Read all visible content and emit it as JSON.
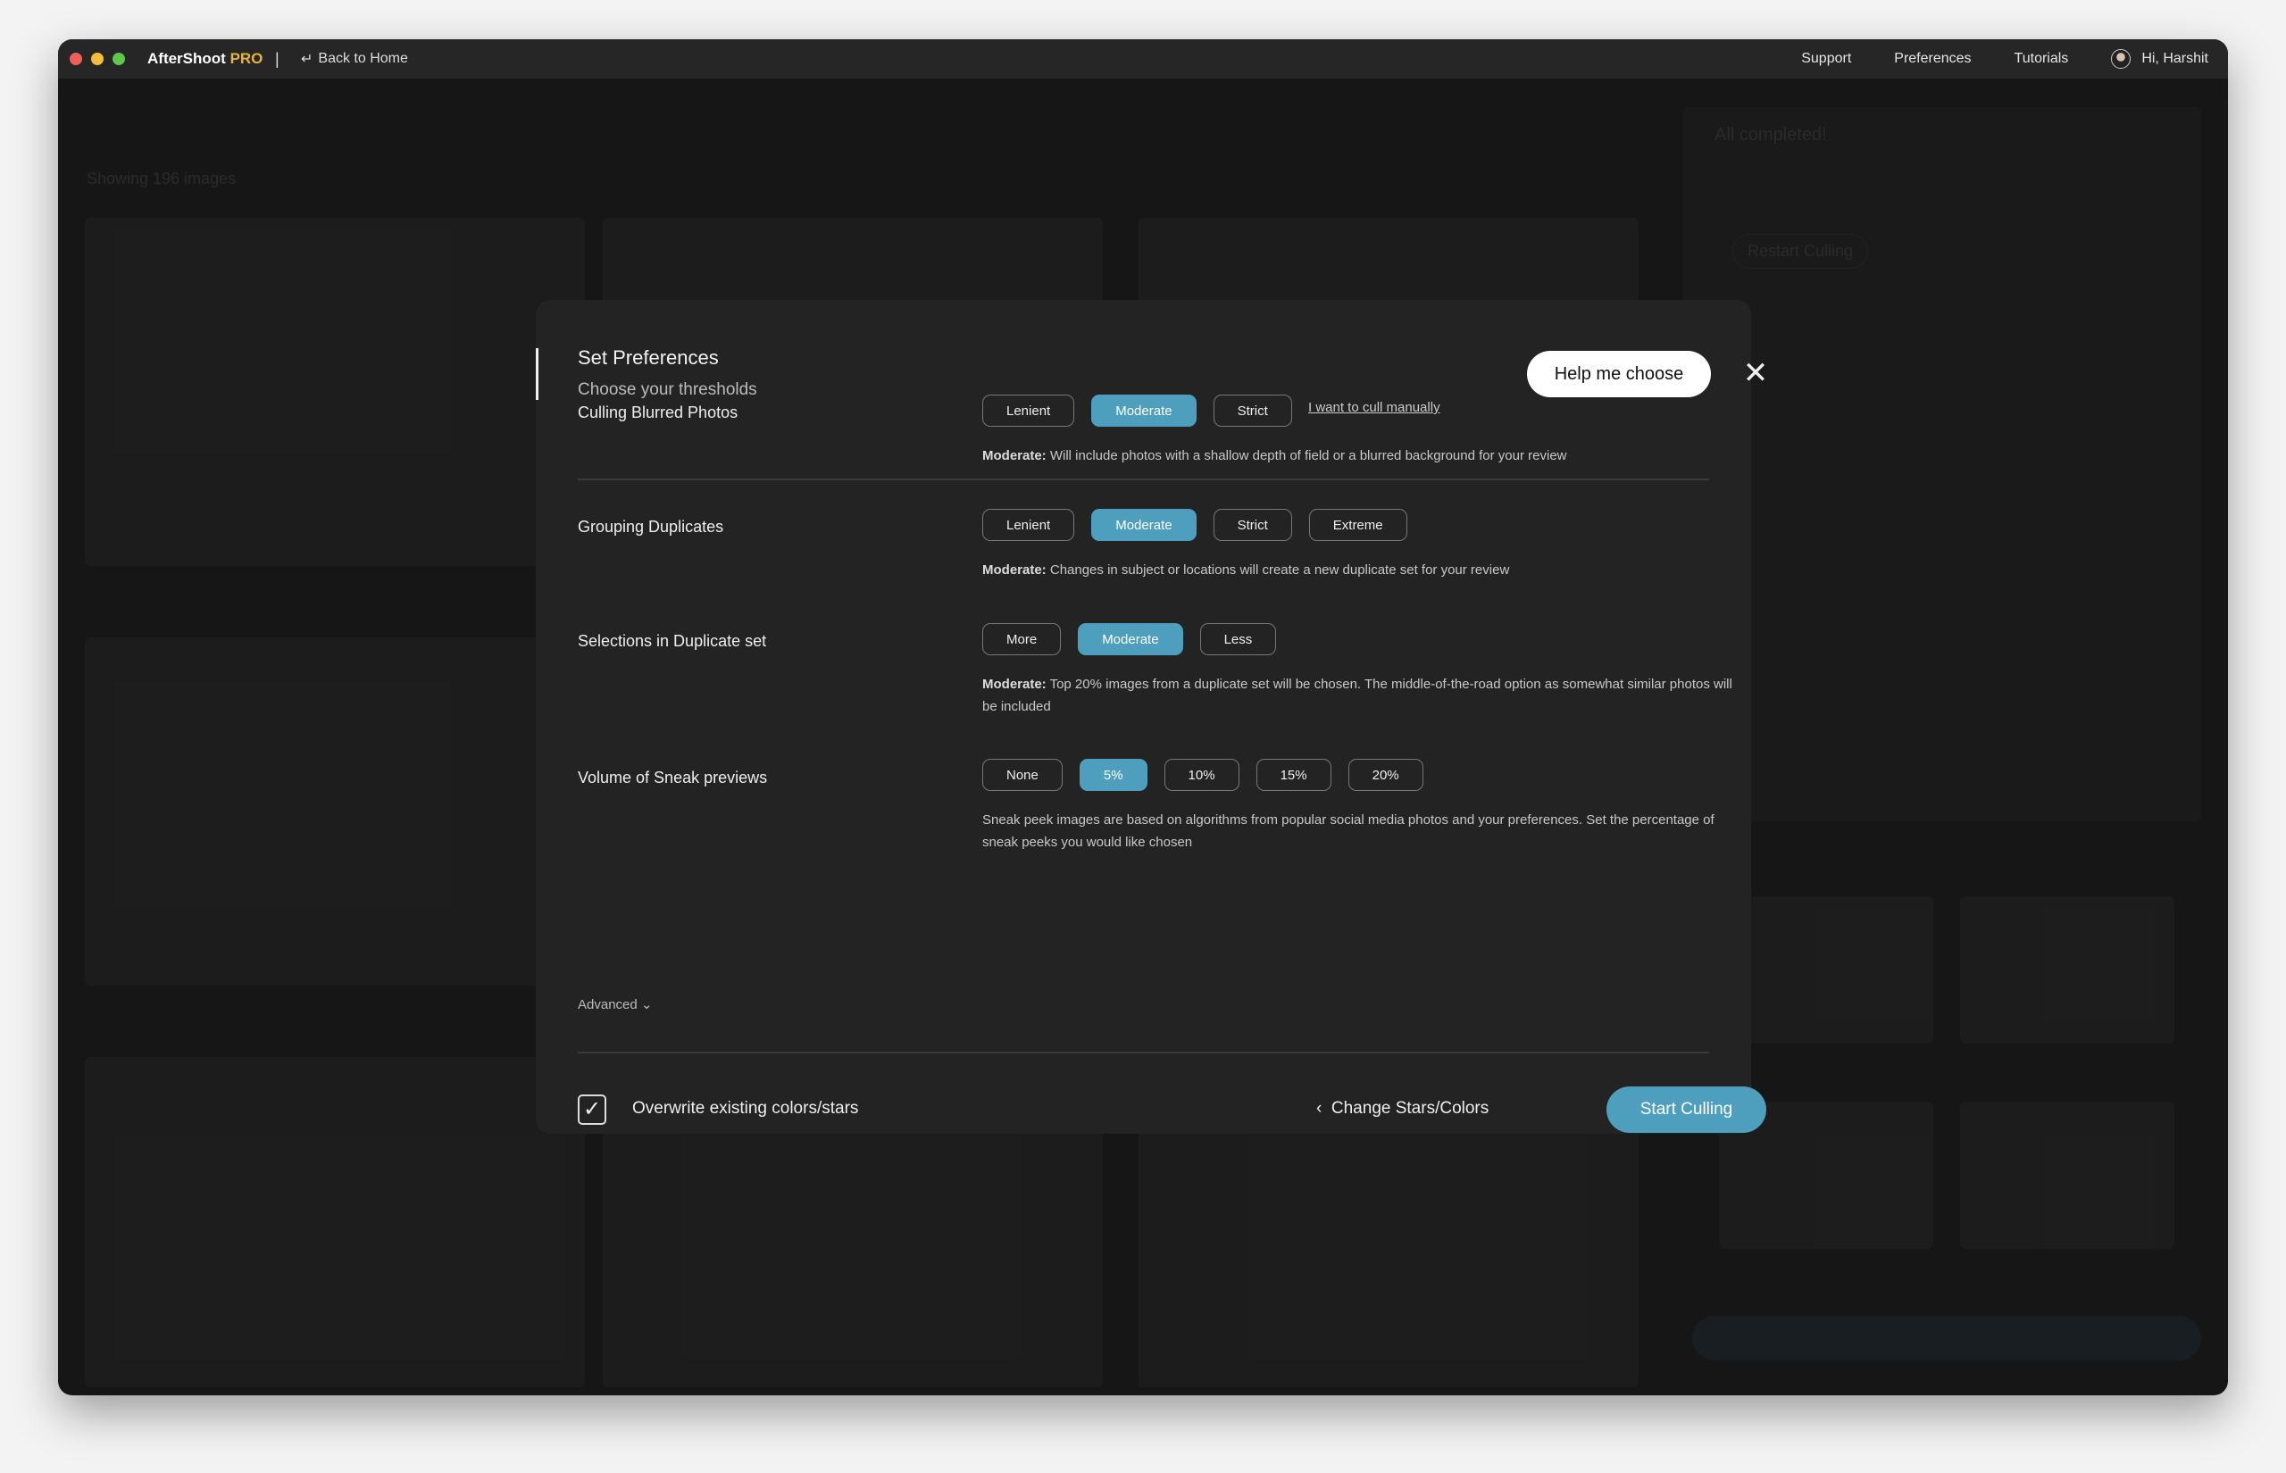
{
  "titlebar": {
    "app_name": "AfterShoot",
    "app_badge": "PRO",
    "separator": "|",
    "back_label": "Back to Home",
    "nav": [
      "Support",
      "Preferences",
      "Tutorials"
    ],
    "greeting": "Hi, Harshit"
  },
  "background": {
    "showing": "Showing 196 images",
    "status": "All completed!",
    "restart": "Restart Culling"
  },
  "modal": {
    "title": "Set Preferences",
    "subtitle": "Choose your thresholds",
    "manual_link": "I want to cull manually",
    "help_button": "Help me choose",
    "close": "✕",
    "rows": [
      {
        "label": "Culling Blurred Photos",
        "options": [
          "Lenient",
          "Moderate",
          "Strict"
        ],
        "selected": "Moderate",
        "desc_bold": "Moderate:",
        "desc": " Will include photos with a shallow depth of field or a blurred background for your review"
      },
      {
        "label": "Grouping Duplicates",
        "options": [
          "Lenient",
          "Moderate",
          "Strict",
          "Extreme"
        ],
        "selected": "Moderate",
        "desc_bold": "Moderate:",
        "desc": " Changes in subject or locations will create a new duplicate set for your review"
      },
      {
        "label": "Selections in Duplicate set",
        "options": [
          "More",
          "Moderate",
          "Less"
        ],
        "selected": "Moderate",
        "desc_bold": "Moderate:",
        "desc": " Top 20% images from a duplicate set will be chosen. The middle-of-the-road option as somewhat similar photos will be included"
      },
      {
        "label": "Volume of Sneak previews",
        "options": [
          "None",
          "5%",
          "10%",
          "15%",
          "20%"
        ],
        "selected": "5%",
        "desc_bold": "",
        "desc": "Sneak peek images are based on algorithms from popular social media photos and your preferences. Set the percentage of sneak peeks you would like chosen"
      }
    ],
    "advanced": "Advanced",
    "overwrite_label": "Overwrite existing colors/stars",
    "overwrite_checked": true,
    "change_label": "Change Stars/Colors",
    "start_button": "Start Culling"
  },
  "colors": {
    "accent": "#4e9fbd",
    "brand_pro": "#e8b53b"
  }
}
